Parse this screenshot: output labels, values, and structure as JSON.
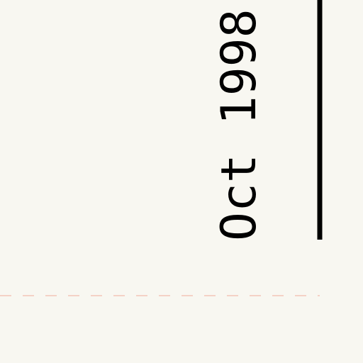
{
  "chart_data": {
    "type": "line",
    "x_tick_labels": [
      "Oct 1998"
    ],
    "colors": {
      "background": "#f8f7f1",
      "axis": "#000000",
      "tick_text": "#000000",
      "reference_line": "#f3c6b8"
    },
    "grid": false,
    "reference_line_style": "dashed"
  }
}
